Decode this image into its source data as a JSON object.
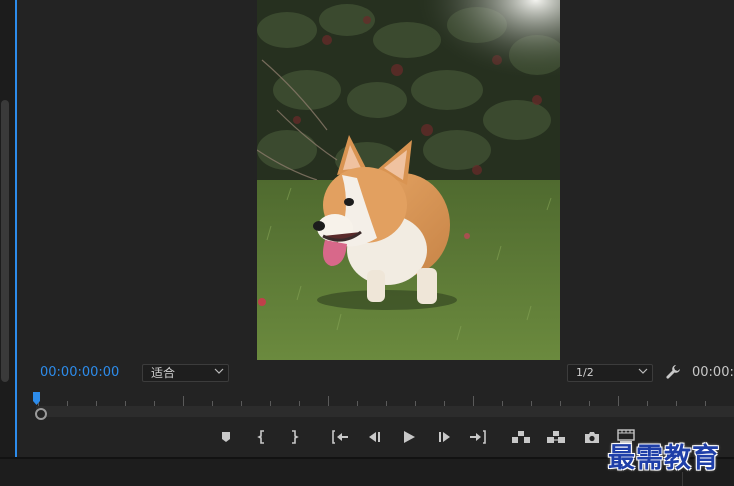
{
  "monitor": {
    "timecode": "00:00:00:00",
    "fit_label": "适合",
    "resolution_label": "1/2",
    "right_timecode": "00:00:0",
    "accent_color": "#2d8ceb"
  },
  "controls": [
    {
      "name": "add-marker-button",
      "icon": "marker-icon"
    },
    {
      "name": "mark-in-button",
      "icon": "mark-in-icon"
    },
    {
      "name": "mark-out-button",
      "icon": "mark-out-icon"
    },
    {
      "name": "go-to-in-button",
      "icon": "go-to-in-icon"
    },
    {
      "name": "step-back-button",
      "icon": "step-back-icon"
    },
    {
      "name": "play-button",
      "icon": "play-icon"
    },
    {
      "name": "step-forward-button",
      "icon": "step-forward-icon"
    },
    {
      "name": "go-to-out-button",
      "icon": "go-to-out-icon"
    },
    {
      "name": "lift-button",
      "icon": "lift-icon"
    },
    {
      "name": "extract-button",
      "icon": "extract-icon"
    },
    {
      "name": "export-frame-button",
      "icon": "camera-icon"
    },
    {
      "name": "comparison-view-button",
      "icon": "comparison-view-icon"
    }
  ],
  "watermark": "最需教育"
}
